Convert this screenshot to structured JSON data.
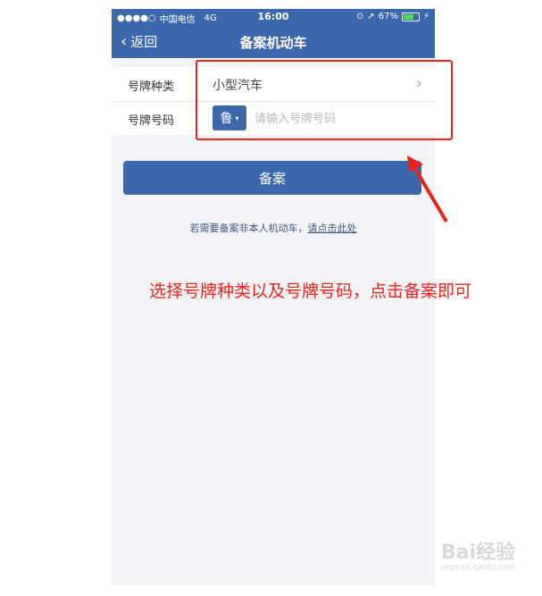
{
  "status_bar": {
    "signal": "●●●●○",
    "carrier": "中国电信",
    "network": "4G",
    "time": "16:00",
    "battery": "67%",
    "battery_level": 0.67
  },
  "nav": {
    "back_label": "返回",
    "title": "备案机动车"
  },
  "form": {
    "plate_type_label": "号牌种类",
    "plate_type_value": "小型汽车",
    "plate_number_label": "号牌号码",
    "province": "鲁",
    "plate_number_placeholder": "请输入号牌号码",
    "plate_number_value": ""
  },
  "submit_label": "备案",
  "tip": {
    "text": "若需要备案非本人机动车，",
    "link": "请点击此处"
  },
  "annotation": {
    "text": "选择号牌种类以及号牌号码，点击备案即可"
  },
  "watermark": {
    "text": "Bai经验",
    "url": "jingyan.baidu.com"
  },
  "colors": {
    "brand_blue": "#3c67ac",
    "annotation_red": "#e8231b"
  }
}
